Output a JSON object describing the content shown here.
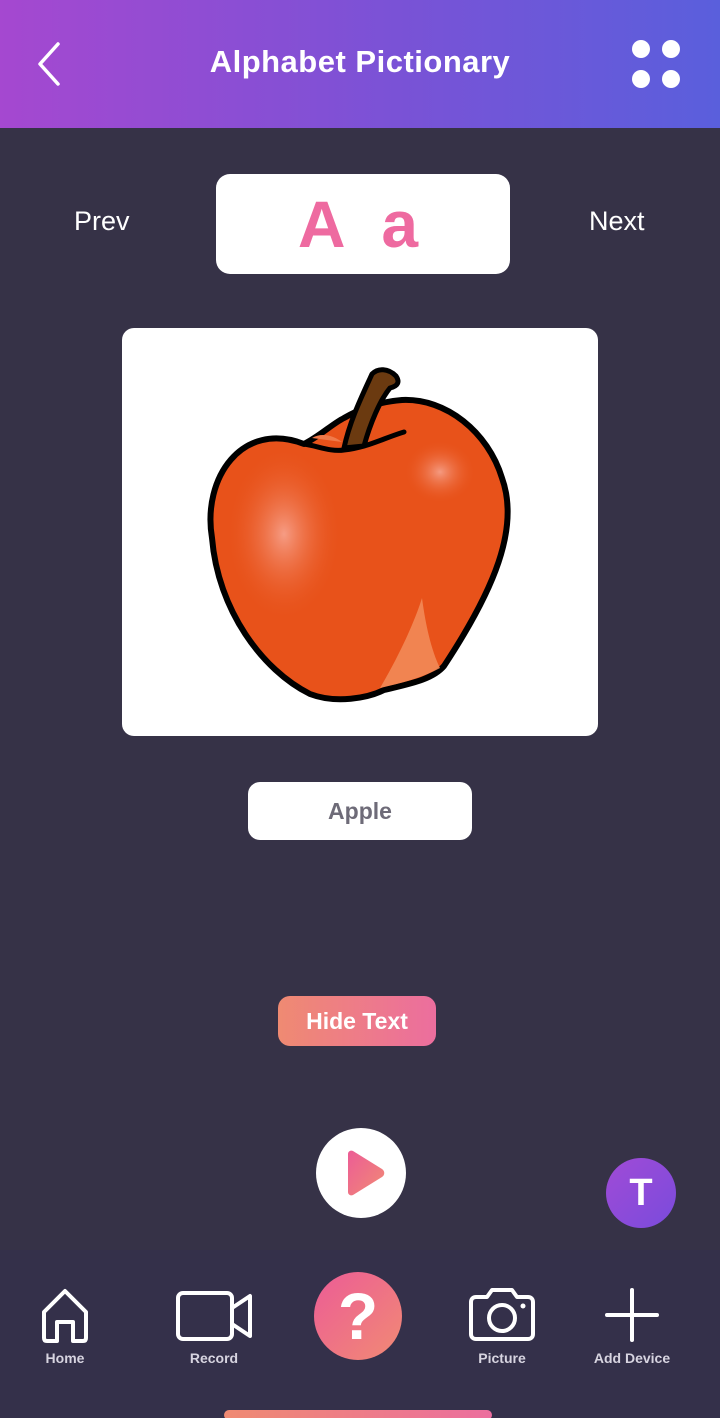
{
  "header": {
    "title": "Alphabet Pictionary",
    "back_icon": "chevron-left-icon",
    "menu_icon": "grid-dots-icon"
  },
  "navigation": {
    "prev_label": "Prev",
    "next_label": "Next",
    "letter": "A a"
  },
  "card": {
    "image_icon": "apple-icon",
    "word": "Apple"
  },
  "controls": {
    "hide_text_label": "Hide Text",
    "play_icon": "play-icon",
    "avatar_initial": "T"
  },
  "tabbar": {
    "items": [
      {
        "label": "Home",
        "icon": "home-icon"
      },
      {
        "label": "Record",
        "icon": "video-camera-icon"
      },
      {
        "label": "?",
        "icon": "help-icon"
      },
      {
        "label": "Picture",
        "icon": "camera-icon"
      },
      {
        "label": "Add Device",
        "icon": "plus-icon"
      }
    ]
  },
  "colors": {
    "background": "#363247",
    "header_start": "#a548d0",
    "header_end": "#5a5fdc",
    "letter_pink": "#ee6aa0",
    "accent_coral": "#ef8a72"
  }
}
